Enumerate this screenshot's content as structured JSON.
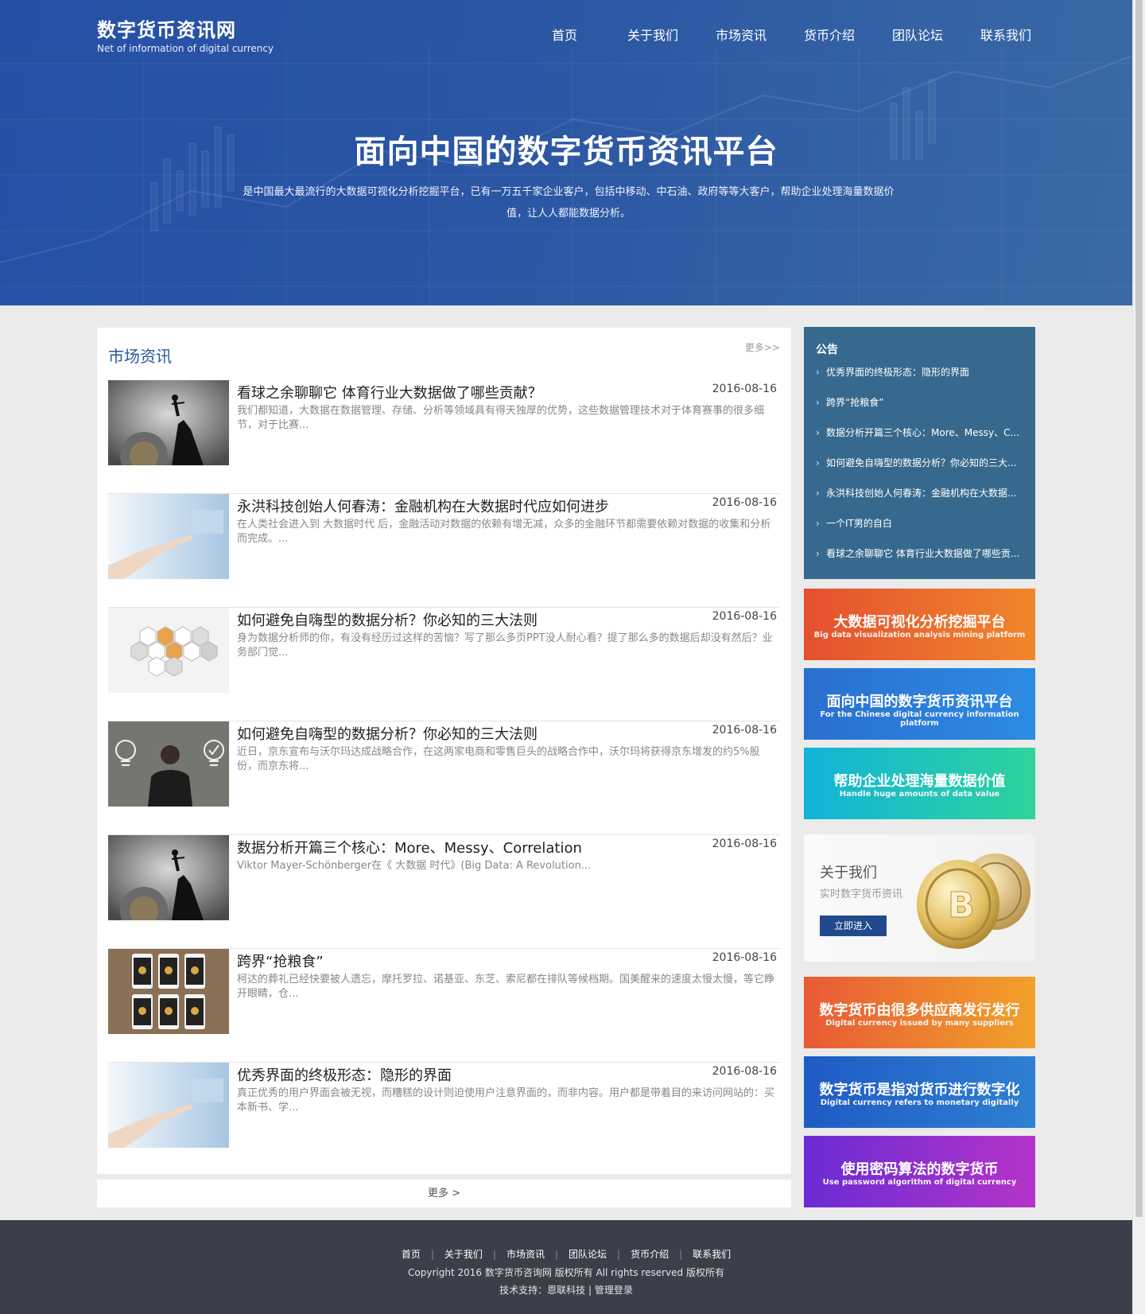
{
  "header": {
    "logo_cn": "数字货币资讯网",
    "logo_en": "Net of information of digital currency",
    "nav": [
      "首页",
      "关于我们",
      "市场资讯",
      "货币介绍",
      "团队论坛",
      "联系我们"
    ]
  },
  "hero": {
    "title": "面向中国的数字货币资讯平台",
    "desc": "是中国最大最流行的大数据可视化分析挖掘平台，已有一万五千家企业客户，包括中移动、中石油、政府等等大客户，帮助企业处理海量数据价值，让人人都能数据分析。"
  },
  "market": {
    "title": "市场资讯",
    "more": "更多>>",
    "articles": [
      {
        "title": "看球之余聊聊它 体育行业大数据做了哪些贡献？",
        "date": "2016-08-16",
        "summary": "我们都知道，大数据在数据管理、存储、分析等领域具有得天独厚的优势，这些数据管理技术对于体育赛事的很多细节，对于比赛...",
        "thumb": "climber-icon"
      },
      {
        "title": "永洪科技创始人何春涛：金融机构在大数据时代应如何进步",
        "date": "2016-08-16",
        "summary": "在人类社会进入到 大数据时代 后，金融活动对数据的依赖有增无减，众多的金融环节都需要依赖对数据的收集和分析而完成。...",
        "thumb": "hand-pointing-icon"
      },
      {
        "title": "如何避免自嗨型的数据分析？你必知的三大法则",
        "date": "2016-08-16",
        "summary": "身为数据分析师的你，有没有经历过这样的苦恼？写了那么多页PPT没人耐心看？提了那么多的数据后却没有然后？业务部门觉...",
        "thumb": "hexagons-icon"
      },
      {
        "title": "如何避免自嗨型的数据分析？你必知的三大法则",
        "date": "2016-08-16",
        "summary": "近日，京东宣布与沃尔玛达成战略合作，在这两家电商和零售巨头的战略合作中，沃尔玛将获得京东增发的约5%股份，而京东将...",
        "thumb": "lightbulb-man-icon"
      },
      {
        "title": "数据分析开篇三个核心：More、Messy、Correlation",
        "date": "2016-08-16",
        "summary": "Viktor Mayer-Schönberger在《 大数据 时代》(Big Data: A Revolution...",
        "thumb": "climber-icon"
      },
      {
        "title": "跨界“抢粮食”",
        "date": "2016-08-16",
        "summary": "柯达的葬礼已经快要被人遗忘，摩托罗拉、诺基亚、东芝、索尼都在排队等候档期。国美醒来的速度太慢太慢，等它睁开眼睛，仓...",
        "thumb": "phones-icon"
      },
      {
        "title": "优秀界面的终极形态：隐形的界面",
        "date": "2016-08-16",
        "summary": "真正优秀的用户界面会被无视，而糟糕的设计则迫使用户注意界面的，而非内容。用户都是带着目的来访问网站的：买本新书、学...",
        "thumb": "hand-pointing-icon"
      }
    ],
    "more_bar": "更多 >"
  },
  "notice": {
    "title": "公告",
    "items": [
      "优秀界面的终极形态：隐形的界面",
      "跨界“抢粮食”",
      "数据分析开篇三个核心：More、Messy、C...",
      "如何避免自嗨型的数据分析？你必知的三大...",
      "永洪科技创始人何春涛：金融机构在大数据...",
      "一个IT男的自白",
      "看球之余聊聊它 体育行业大数据做了哪些贡..."
    ]
  },
  "banners_top": [
    {
      "title": "大数据可视化分析挖掘平台",
      "sub": "Big data visualization analysis mining platform",
      "color1": "#e4502f",
      "color2": "#f1862b"
    },
    {
      "title": "面向中国的数字货币资讯平台",
      "sub": "For the Chinese digital currency information platform",
      "color1": "#2a6fd0",
      "color2": "#2d8be3"
    },
    {
      "title": "帮助企业处理海量数据价值",
      "sub": "Handle huge amounts of data value",
      "color1": "#12b3d8",
      "color2": "#2fd39c"
    }
  ],
  "about": {
    "title": "关于我们",
    "sub": "实时数字货币资讯",
    "button": "立即进入"
  },
  "banners_bottom": [
    {
      "title": "数字货币由很多供应商发行发行",
      "sub": "Digital currency issued by many suppliers",
      "color1": "#e85a35",
      "color2": "#f2a12a"
    },
    {
      "title": "数字货币是指对货币进行数字化",
      "sub": "Digital currency refers to monetary digitally",
      "color1": "#1f5bc4",
      "color2": "#2e7fd3"
    },
    {
      "title": "使用密码算法的数字货币",
      "sub": "Use password algorithm of digital currency",
      "color1": "#6a2bd3",
      "color2": "#b434c9"
    }
  ],
  "footer": {
    "links": [
      "首页",
      "关于我们",
      "市场资讯",
      "团队论坛",
      "货币介绍",
      "联系我们"
    ],
    "copyright": "Copyright 2016 数字货币咨询网 版权所有 All rights reserved 版权所有",
    "support": "技术支持：恩联科技 | 管理登录"
  }
}
